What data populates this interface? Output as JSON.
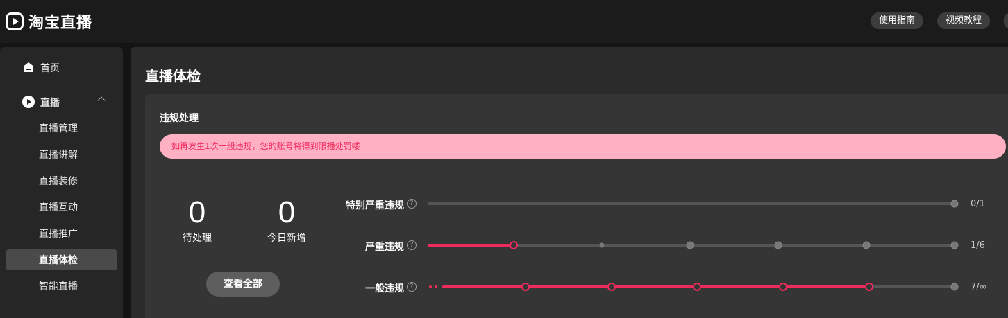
{
  "header": {
    "logo_text": "淘宝直播",
    "buttons": [
      {
        "label": "使用指南"
      },
      {
        "label": "视频教程"
      }
    ]
  },
  "sidebar": {
    "home": {
      "label": "首页",
      "icon": "home-icon"
    },
    "live": {
      "label": "直播",
      "icon": "play-circle-icon",
      "expanded": true
    },
    "items": [
      {
        "label": "直播管理"
      },
      {
        "label": "直播讲解"
      },
      {
        "label": "直播装修"
      },
      {
        "label": "直播互动"
      },
      {
        "label": "直播推广"
      },
      {
        "label": "直播体检",
        "active": true
      },
      {
        "label": "智能直播"
      }
    ]
  },
  "main": {
    "page_title": "直播体检",
    "card_title": "违规处理",
    "alert_text": "如再发生1次一般违规，您的账号将得到限播处罚喽",
    "stats": [
      {
        "value": "0",
        "label": "待处理"
      },
      {
        "value": "0",
        "label": "今日新增"
      }
    ],
    "view_all_label": "查看全部",
    "violations": [
      {
        "label": "特别严重违规",
        "count": "0/1",
        "current": 0,
        "max": 1
      },
      {
        "label": "严重违规",
        "count": "1/6",
        "current": 1,
        "max": 6
      },
      {
        "label": "一般违规",
        "count": "7/∞",
        "current": 5,
        "max": null
      }
    ]
  },
  "colors": {
    "accent": "#ef2b5d",
    "alert_bg": "#ffb1c3",
    "track": "#555555",
    "node_inactive": "#777777"
  }
}
